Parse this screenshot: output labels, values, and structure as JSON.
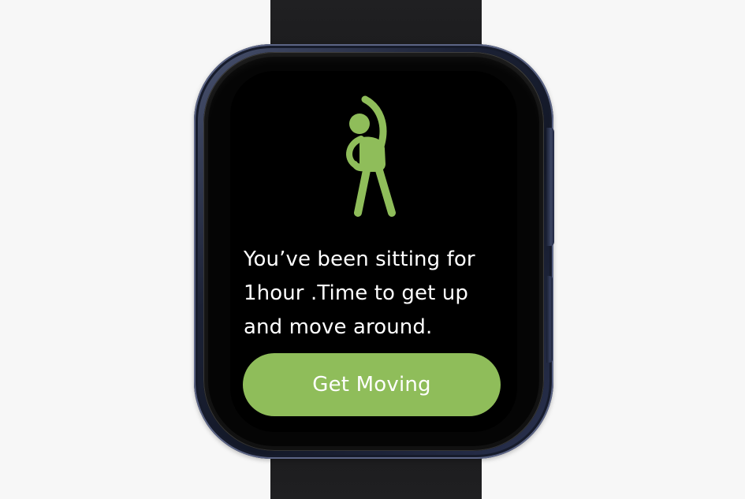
{
  "notification": {
    "icon": "stretching-person-icon",
    "message": "You’ve been sitting for\n1hour .Time to get up\nand move around.",
    "action_label": "Get Moving"
  },
  "colors": {
    "accent": "#8fbd5a",
    "screen_background": "#000000",
    "text": "#ffffff",
    "page_background": "#f7f7f7",
    "watch_case": "#1c2236",
    "strap": "#1b1b1d"
  }
}
